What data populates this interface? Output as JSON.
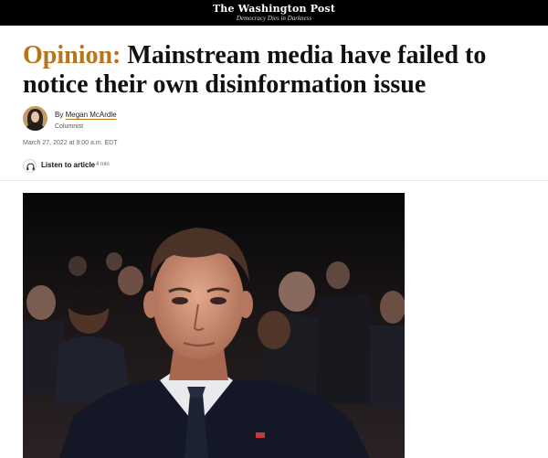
{
  "masthead": {
    "name": "The Washington Post",
    "tagline": "Democracy Dies in Darkness"
  },
  "article": {
    "kicker": "Opinion:",
    "headline": "Mainstream media have failed to notice their own disinformation issue",
    "byline_prefix": "By",
    "author": "Megan McArdle",
    "author_role": "Columnist",
    "date": "March 27, 2022 at 9:00 a.m. EDT"
  },
  "audio": {
    "label": "Listen to article",
    "duration": "4 min",
    "icon": "headphones-icon"
  },
  "colors": {
    "kicker": "#b8741a",
    "topbar": "#000000"
  }
}
